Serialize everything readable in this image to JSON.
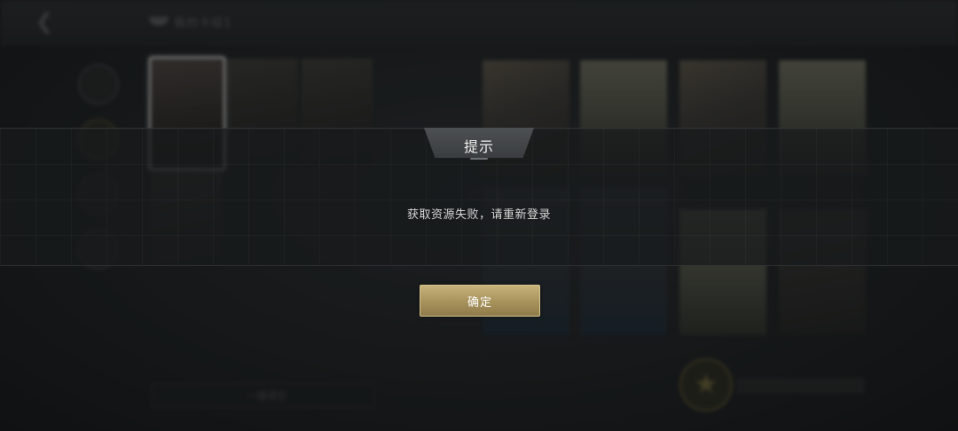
{
  "background": {
    "mode_title": "我的卡组1",
    "bottom_bar_label": "一键清空"
  },
  "dialog": {
    "title": "提示",
    "message": "获取资源失败，请重新登录",
    "confirm_label": "确定"
  },
  "colors": {
    "accent_gold": "#b8a26a",
    "dialog_band": "#181a1c",
    "text_primary": "#f0f0f0"
  }
}
